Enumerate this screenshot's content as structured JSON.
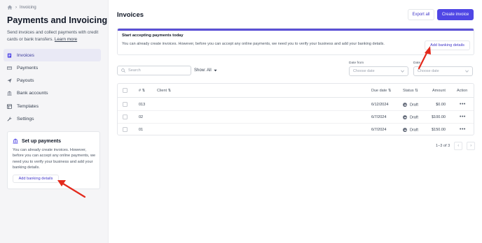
{
  "breadcrumb": {
    "current": "Invoicing"
  },
  "sidebar": {
    "title": "Payments and Invoicing",
    "description": "Send invoices and collect payments with credit cards or bank transfers.",
    "learn_more": "Learn more",
    "items": [
      {
        "label": "Invoices",
        "icon": "invoice-icon",
        "active": true
      },
      {
        "label": "Payments",
        "icon": "card-icon"
      },
      {
        "label": "Payouts",
        "icon": "send-icon"
      },
      {
        "label": "Bank accounts",
        "icon": "bank-icon"
      },
      {
        "label": "Templates",
        "icon": "template-icon"
      },
      {
        "label": "Settings",
        "icon": "wrench-icon"
      }
    ],
    "setup_card": {
      "title": "Set up payments",
      "text": "You can already create invoices. However, before you can accept any online payments, we need you to verify your business and add your banking details.",
      "button": "Add banking details"
    }
  },
  "main": {
    "title": "Invoices",
    "export_button": "Export all",
    "create_button": "Create invoice",
    "banner": {
      "title": "Start accepting payments today",
      "text": "You can already create invoices. However, before you can accept any online payments, we need you to verify your business and add your banking details.",
      "button": "Add banking details"
    },
    "filters": {
      "search_placeholder": "Search",
      "show": "Show: All",
      "date_from_label": "Date from",
      "date_from_placeholder": "Choose date",
      "date_to_label": "Date",
      "date_to_placeholder": "Choose date"
    },
    "table": {
      "headers": {
        "number": "#",
        "client": "Client",
        "due_date": "Due date",
        "status": "Status",
        "amount": "Amount",
        "action": "Action"
      },
      "rows": [
        {
          "number": "013",
          "client": "",
          "due_date": "6/12/2024",
          "status": "Draft",
          "amount": "$0.00"
        },
        {
          "number": "02",
          "client": "",
          "due_date": "6/7/2024",
          "status": "Draft",
          "amount": "$100.00"
        },
        {
          "number": "01",
          "client": "",
          "due_date": "6/7/2024",
          "status": "Draft",
          "amount": "$150.00"
        }
      ]
    },
    "pagination": {
      "range": "1–3 of 3"
    }
  },
  "colors": {
    "accent": "#4f46e5",
    "annotation_arrow": "#e3291c"
  }
}
